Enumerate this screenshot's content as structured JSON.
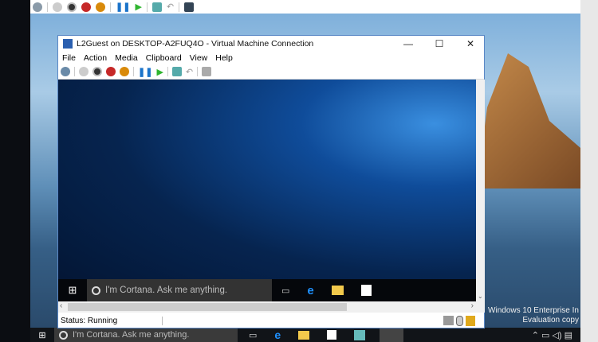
{
  "host_toolbar": {
    "icons": [
      "ctrl-alt-del-icon",
      "start-icon",
      "turn-off-icon",
      "shutdown-icon",
      "power-icon",
      "pause-icon",
      "resume-icon",
      "checkpoint-icon",
      "revert-icon",
      "enhanced-session-icon"
    ]
  },
  "vm_window": {
    "title": "L2Guest on DESKTOP-A2FUQ4O - Virtual Machine Connection",
    "controls": {
      "minimize": "—",
      "maximize": "☐",
      "close": "✕"
    },
    "menu": [
      "File",
      "Action",
      "Media",
      "Clipboard",
      "View",
      "Help"
    ],
    "status": "Status: Running"
  },
  "guest_taskbar": {
    "search_placeholder": "I'm Cortana. Ask me anything."
  },
  "host_taskbar": {
    "search_placeholder": "I'm Cortana. Ask me anything."
  },
  "watermark": {
    "line1": "Windows 10 Enterprise In",
    "line2": "Evaluation copy"
  }
}
